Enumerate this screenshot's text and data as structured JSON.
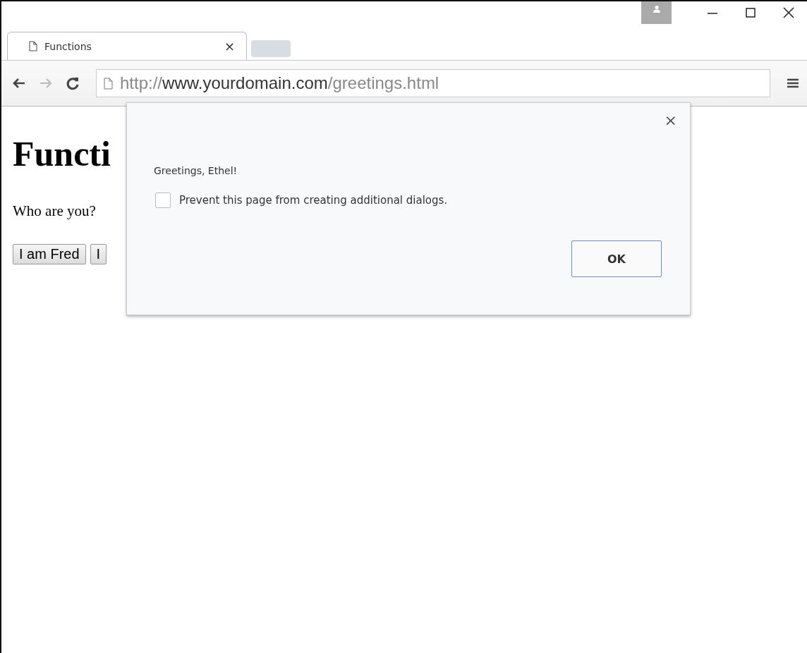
{
  "browser": {
    "tab": {
      "title": "Functions",
      "close": "×",
      "selected": true
    },
    "address": {
      "scheme": "http://",
      "host": "www.yourdomain.com",
      "path": "/greetings.html"
    }
  },
  "page": {
    "heading": "Functi",
    "prompt": "Who are you?",
    "buttons": [
      "I am Fred",
      "I"
    ]
  },
  "dialog": {
    "close": "×",
    "message": "Greetings, Ethel!",
    "checkbox": {
      "label": "Prevent this page from creating additional dialogs.",
      "checked": false
    },
    "button": "OK"
  }
}
